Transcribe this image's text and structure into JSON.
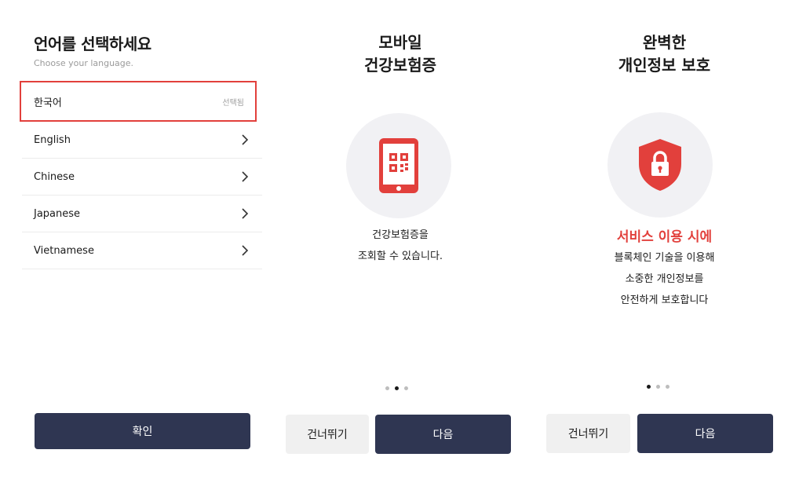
{
  "language_screen": {
    "title": "언어를 선택하세요",
    "subtitle": "Choose your language.",
    "languages": [
      {
        "label": "한국어",
        "status": "선택됨",
        "selected": true
      },
      {
        "label": "English",
        "selected": false
      },
      {
        "label": "Chinese",
        "selected": false
      },
      {
        "label": "Japanese",
        "selected": false
      },
      {
        "label": "Vietnamese",
        "selected": false
      }
    ],
    "confirm_label": "확인"
  },
  "onboarding_1": {
    "title_lines": [
      "모바일",
      "건강보험증"
    ],
    "icon": "phone-qr-icon",
    "description_lines": [
      "건강보험증을",
      "조회할 수 있습니다."
    ],
    "page_count": 3,
    "current_page": 2,
    "skip_label": "건너뛰기",
    "next_label": "다음"
  },
  "onboarding_2": {
    "title_lines": [
      "완벽한",
      "개인정보 보호"
    ],
    "icon": "shield-lock-icon",
    "highlight": "서비스 이용 시에",
    "description_lines": [
      "블록체인 기술을 이용해",
      "소중한 개인정보를",
      "안전하게 보호합니다"
    ],
    "page_count": 3,
    "current_page": 1,
    "skip_label": "건너뛰기",
    "next_label": "다음"
  },
  "colors": {
    "accent": "#e2403c",
    "primary_button": "#2f3652",
    "secondary_button": "#f0f0f0",
    "icon_circle": "#f1f1f4"
  }
}
